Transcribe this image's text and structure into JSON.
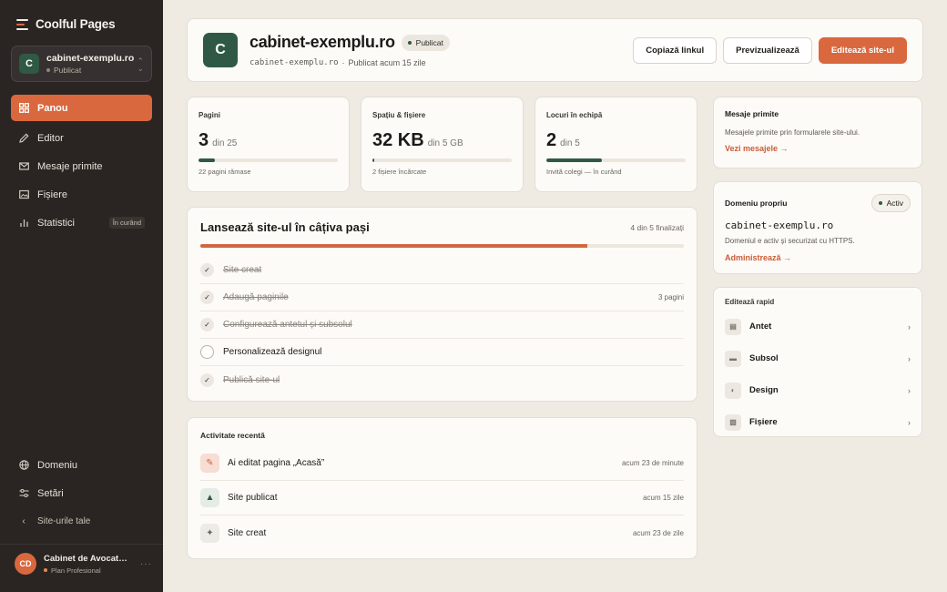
{
  "brand": {
    "name": "Coolful Pages",
    "icon": "menu-stack-icon"
  },
  "site_switcher": {
    "initial": "C",
    "name": "cabinet-exemplu.ro",
    "status": "Publicat"
  },
  "nav": {
    "items": [
      {
        "label": "Panou",
        "icon": "grid-icon",
        "active": true
      },
      {
        "label": "Editor",
        "icon": "pencil-icon"
      },
      {
        "label": "Mesaje primite",
        "icon": "mail-icon"
      },
      {
        "label": "Fișiere",
        "icon": "image-icon"
      },
      {
        "label": "Statistici",
        "icon": "chart-icon",
        "badge": "În curând"
      }
    ],
    "bottom": [
      {
        "label": "Domeniu",
        "icon": "globe-icon"
      },
      {
        "label": "Setări",
        "icon": "sliders-icon"
      },
      {
        "label": "Site-urile tale",
        "icon": "chevron-left-icon"
      }
    ]
  },
  "user": {
    "initials": "CD",
    "name": "Cabinet de Avocatură D...",
    "plan": "Plan Profesional"
  },
  "header": {
    "initial": "C",
    "title": "cabinet-exemplu.ro",
    "badge": "Publicat",
    "domain": "cabinet-exemplu.ro",
    "separator": "·",
    "published": "Publicat acum 15 zile",
    "actions": {
      "copy": "Copiază linkul",
      "preview": "Previzualizează",
      "edit": "Editează site-ul"
    }
  },
  "stats": [
    {
      "label": "Pagini",
      "value": "3",
      "of": "din 25",
      "progress": 0.12,
      "note": "22 pagini rămase"
    },
    {
      "label": "Spațiu & fișiere",
      "value": "32 KB",
      "of": "din 5 GB",
      "progress": 0.01,
      "note": "2 fișiere încărcate"
    },
    {
      "label": "Locuri în echipă",
      "value": "2",
      "of": "din 5",
      "progress": 0.4,
      "note": "Invită colegi — în curând"
    }
  ],
  "steps": {
    "title": "Lansează site-ul în câțiva pași",
    "count": "4 din 5 finalizați",
    "progress": 0.8,
    "items": [
      {
        "label": "Site creat",
        "done": true,
        "meta": ""
      },
      {
        "label": "Adaugă paginile",
        "done": true,
        "meta": "3 pagini"
      },
      {
        "label": "Configurează antetul și subsolul",
        "done": true,
        "meta": ""
      },
      {
        "label": "Personalizează designul",
        "done": false,
        "meta": ""
      },
      {
        "label": "Publică site-ul",
        "done": true,
        "meta": ""
      }
    ]
  },
  "activity": {
    "title": "Activitate recentă",
    "items": [
      {
        "label": "Ai editat pagina „Acasă”",
        "time": "acum 23 de minute",
        "icon": "pencil-icon",
        "glyph": "✎"
      },
      {
        "label": "Site publicat",
        "time": "acum 15 zile",
        "icon": "triangle-up-icon",
        "glyph": "▲"
      },
      {
        "label": "Site creat",
        "time": "acum 23 de zile",
        "icon": "sparkle-icon",
        "glyph": "✦"
      }
    ]
  },
  "messages": {
    "title": "Mesaje primite",
    "desc": "Mesajele primite prin formularele site-ului.",
    "link": "Vezi mesajele →"
  },
  "domain": {
    "title": "Domeniu propriu",
    "badge": "Activ",
    "name": "cabinet-exemplu.ro",
    "desc": "Domeniul e activ și securizat cu HTTPS.",
    "link": "Administrează →"
  },
  "quick": {
    "title": "Editează rapid",
    "items": [
      {
        "label": "Antet",
        "icon": "header-icon",
        "glyph": "▤"
      },
      {
        "label": "Subsol",
        "icon": "footer-icon",
        "glyph": "▬"
      },
      {
        "label": "Design",
        "icon": "contrast-icon",
        "glyph": "◐"
      },
      {
        "label": "Fișiere",
        "icon": "image-icon",
        "glyph": "▧"
      }
    ]
  },
  "colors": {
    "accent": "#d9683e",
    "brand_green": "#2f5944",
    "sidebar": "#2a2522",
    "background": "#efebe3"
  }
}
